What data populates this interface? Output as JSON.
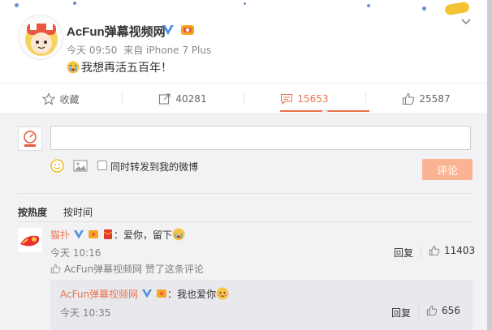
{
  "post": {
    "author": "AcFun弹幕视频网",
    "time": "今天 09:50",
    "source": "来自 iPhone 7 Plus",
    "text": "我想再活五百年！"
  },
  "actions": {
    "favorite": "收藏",
    "repost_count": "40281",
    "comment_count": "15653",
    "like_count": "25587"
  },
  "composer": {
    "repost_label": "同时转发到我的微博",
    "submit": "评论"
  },
  "sort": {
    "hot": "按热度",
    "time": "按时间"
  },
  "comments": [
    {
      "user": "猫扑",
      "text": "：爱你，留下",
      "time": "今天 10:16",
      "reply": "回复",
      "likes": "11403",
      "liked_by": "AcFun弹幕视频网 赞了这条评论",
      "replies": [
        {
          "user": "AcFun弹幕视频网",
          "text": "：我也爱你",
          "time": "今天 10:35",
          "reply": "回复",
          "likes": "656"
        }
      ]
    }
  ],
  "colors": {
    "accent": "#eb7350",
    "panel": "#f2f2f5",
    "submit_disabled": "#fbb493",
    "verified_blue": "#4a90e2"
  },
  "icons": [
    "star-icon",
    "repost-icon",
    "comment-icon",
    "thumbs-up-icon",
    "chevron-down-icon",
    "smile-icon",
    "image-icon",
    "cry-emoji-icon",
    "verified-icon",
    "vip-icon"
  ]
}
